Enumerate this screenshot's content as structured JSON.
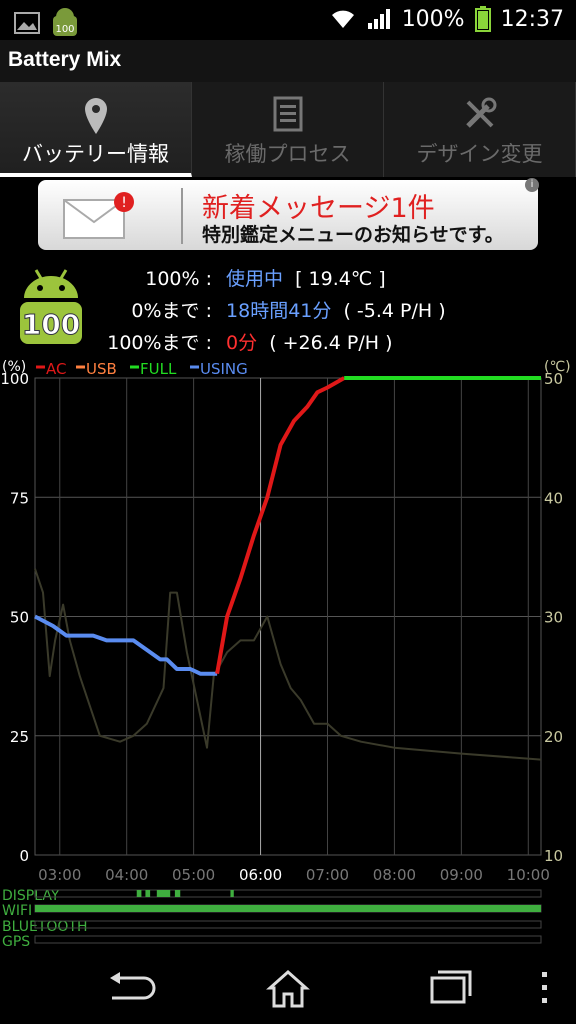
{
  "status_bar": {
    "battery_percent": "100%",
    "time": "12:37",
    "notification_app_badge": "100"
  },
  "app": {
    "title": "Battery Mix"
  },
  "tabs": [
    {
      "label": "バッテリー情報",
      "active": true,
      "icon": "location-pin-icon"
    },
    {
      "label": "稼働プロセス",
      "active": false,
      "icon": "list-icon"
    },
    {
      "label": "デザイン変更",
      "active": false,
      "icon": "tools-icon"
    }
  ],
  "ad": {
    "line1": "新着メッセージ1件",
    "line2": "特別鑑定メニューのお知らせです。",
    "badge": "!",
    "info_icon": "i"
  },
  "battery": {
    "badge": "100",
    "status_label": "100% :",
    "status_value": "使用中",
    "temperature": "[ 19.4℃ ]",
    "to_empty_label": "0%まで :",
    "to_empty_value": "18時間41分",
    "to_empty_rate": "( -5.4 P/H )",
    "to_full_label": "100%まで :",
    "to_full_value": "0分",
    "to_full_rate": "( +26.4 P/H )"
  },
  "colors": {
    "ac": "#e01818",
    "usb": "#ff8040",
    "full": "#22dd22",
    "using": "#5a8cf0",
    "temperature": "#3a3a2a",
    "blue_text": "#6aa0ff",
    "red_text": "#ff3030",
    "axis_right": "#c8c8a0"
  },
  "chart_data": {
    "type": "line",
    "y_left_unit": "(%)",
    "y_right_unit": "(℃)",
    "ylim": [
      0,
      100
    ],
    "y2lim": [
      10,
      50
    ],
    "y_ticks": [
      "100",
      "75",
      "50",
      "25",
      "0"
    ],
    "y2_ticks": [
      "50",
      "40",
      "30",
      "20",
      "10"
    ],
    "x_ticks": [
      "03:00",
      "04:00",
      "05:00",
      "06:00",
      "07:00",
      "08:00",
      "09:00",
      "10:00"
    ],
    "x_tick_hours": [
      3,
      4,
      5,
      6,
      7,
      8,
      9,
      10
    ],
    "xlim_hours": [
      2.63,
      10.19
    ],
    "highlight_tick": "06:00",
    "legend": [
      "AC",
      "USB",
      "FULL",
      "USING"
    ],
    "series": [
      {
        "name": "USING",
        "color_key": "using",
        "x": [
          2.63,
          2.9,
          3.1,
          3.5,
          3.7,
          4.1,
          4.2,
          4.5,
          4.6,
          4.75,
          4.95,
          5.1,
          5.35
        ],
        "y": [
          50,
          48,
          46,
          46,
          45,
          45,
          44,
          41,
          41,
          39,
          39,
          38,
          38
        ]
      },
      {
        "name": "AC",
        "color_key": "ac",
        "x": [
          5.35,
          5.5,
          5.7,
          5.9,
          6.1,
          6.3,
          6.5,
          6.7,
          6.85,
          7.0,
          7.25
        ],
        "y": [
          38,
          50,
          58,
          67,
          75,
          86,
          91,
          94,
          97,
          98,
          100
        ]
      },
      {
        "name": "FULL",
        "color_key": "full",
        "x": [
          7.25,
          10.19
        ],
        "y": [
          100,
          100
        ]
      },
      {
        "name": "",
        "axis": "right",
        "color_key": "temperature",
        "x": [
          2.63,
          2.75,
          2.85,
          2.93,
          3.05,
          3.15,
          3.3,
          3.6,
          3.9,
          4.1,
          4.3,
          4.55,
          4.65,
          4.75,
          4.9,
          5.05,
          5.2,
          5.3,
          5.4,
          5.5,
          5.7,
          5.9,
          6.1,
          6.3,
          6.45,
          6.6,
          6.8,
          7.0,
          7.2,
          7.5,
          8.0,
          9.0,
          10.19
        ],
        "y": [
          34,
          32,
          25,
          28,
          31,
          28,
          25,
          20,
          19.5,
          20,
          21,
          24,
          32,
          32,
          27,
          23,
          19,
          25,
          26,
          27,
          28,
          28,
          30,
          26,
          24,
          23,
          21,
          21,
          20,
          19.5,
          19,
          18.5,
          18
        ]
      }
    ]
  },
  "usage_bars": {
    "labels": [
      "DISPLAY",
      "WIFI",
      "BLUETOOTH",
      "GPS"
    ],
    "display_on_segments_hours": [
      [
        4.15,
        4.22
      ],
      [
        4.28,
        4.35
      ],
      [
        4.45,
        4.65
      ],
      [
        4.72,
        4.8
      ],
      [
        5.55,
        5.6
      ]
    ],
    "wifi_on_segments_hours": [
      [
        2.63,
        10.19
      ]
    ]
  },
  "navigation": {
    "back": "back-icon",
    "home": "home-icon",
    "recents": "recents-icon",
    "menu": "overflow-menu-icon"
  }
}
